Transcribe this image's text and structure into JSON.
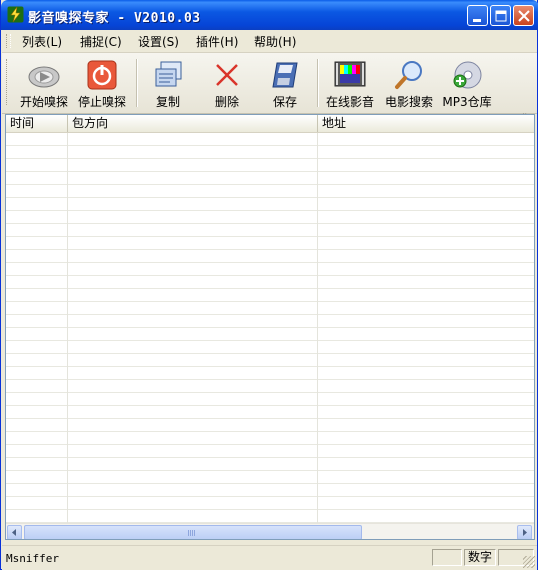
{
  "window": {
    "title": "影音嗅探专家 - V2010.03",
    "colors": {
      "titlebar": "#0b58e3",
      "close": "#c9431d"
    }
  },
  "menu": [
    {
      "label": "列表(L)",
      "name": "menu-list"
    },
    {
      "label": "捕捉(C)",
      "name": "menu-capture"
    },
    {
      "label": "设置(S)",
      "name": "menu-settings"
    },
    {
      "label": "插件(H)",
      "name": "menu-plugins"
    },
    {
      "label": "帮助(H)",
      "name": "menu-help"
    }
  ],
  "toolbar": [
    {
      "label": "开始嗅探",
      "icon": "play-disc-icon"
    },
    {
      "label": "停止嗅探",
      "icon": "stop-power-icon"
    },
    {
      "label": "复制",
      "icon": "copy-icon"
    },
    {
      "label": "删除",
      "icon": "delete-x-icon"
    },
    {
      "label": "保存",
      "icon": "save-floppy-icon"
    },
    {
      "label": "在线影音",
      "icon": "online-media-icon"
    },
    {
      "label": "电影搜索",
      "icon": "magnifier-icon"
    },
    {
      "label": "MP3仓库",
      "icon": "mp3-disc-icon"
    }
  ],
  "list": {
    "columns": [
      "时间",
      "包方向",
      "地址"
    ]
  },
  "status": {
    "text": "Msniffer",
    "panel1": "",
    "panel2": "数字",
    "panel3": ""
  }
}
